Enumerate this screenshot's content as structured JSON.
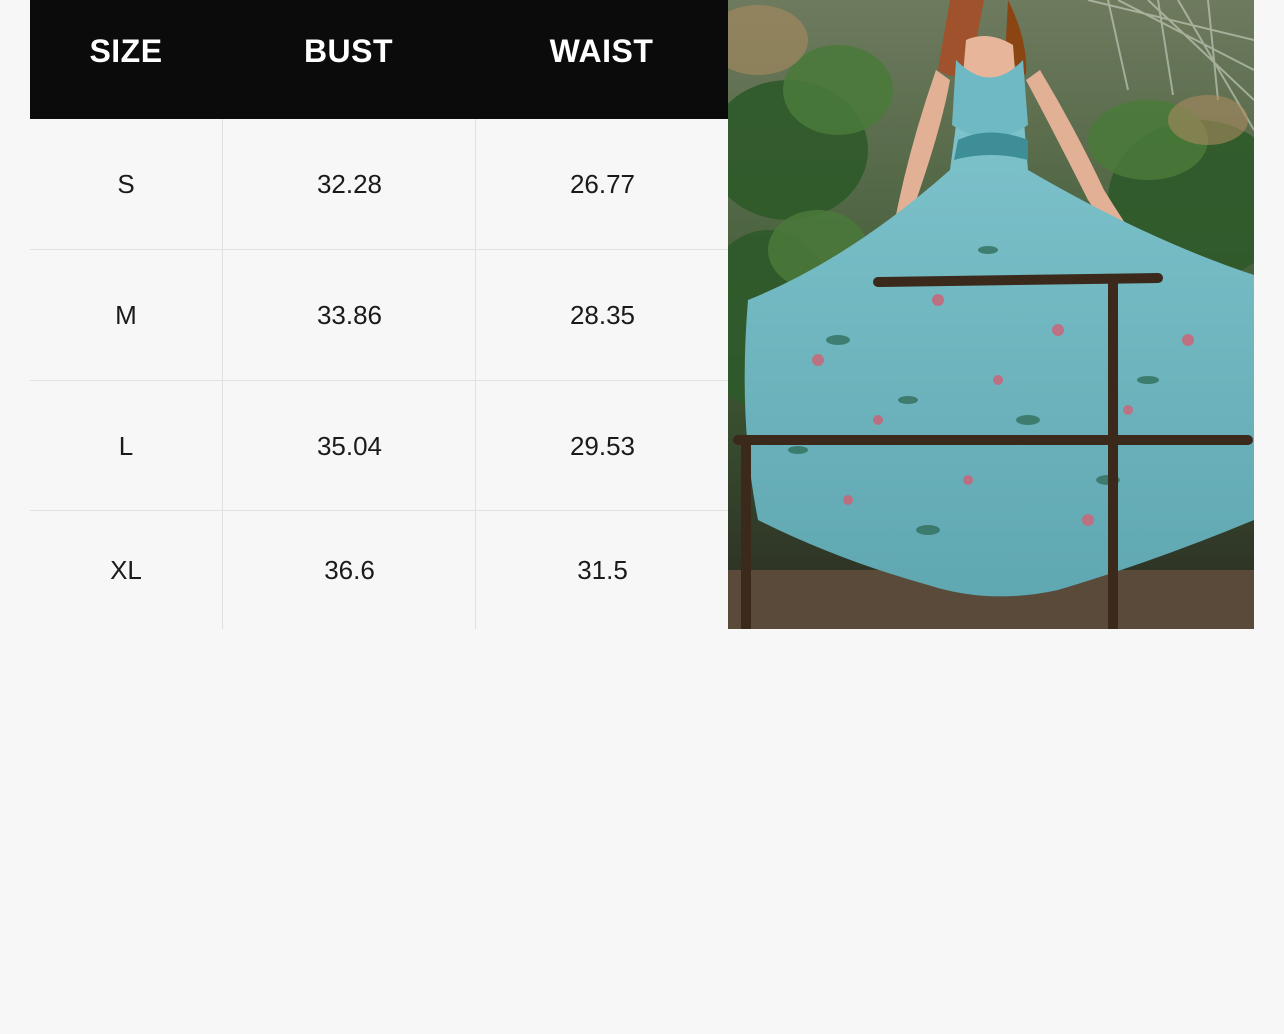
{
  "size_chart": {
    "headers": [
      "SIZE",
      "BUST",
      "WAIST"
    ],
    "rows": [
      {
        "size": "S",
        "bust": "32.28",
        "waist": "26.77"
      },
      {
        "size": "M",
        "bust": "33.86",
        "waist": "28.35"
      },
      {
        "size": "L",
        "bust": "35.04",
        "waist": "29.53"
      },
      {
        "size": "XL",
        "bust": "36.6",
        "waist": "31.5"
      }
    ]
  },
  "colors": {
    "background": "#f7f7f7",
    "header_bg": "#0b0b0b",
    "header_text": "#ffffff",
    "dress": "#6fb9c4"
  },
  "photo": {
    "icon": "product-photo"
  }
}
